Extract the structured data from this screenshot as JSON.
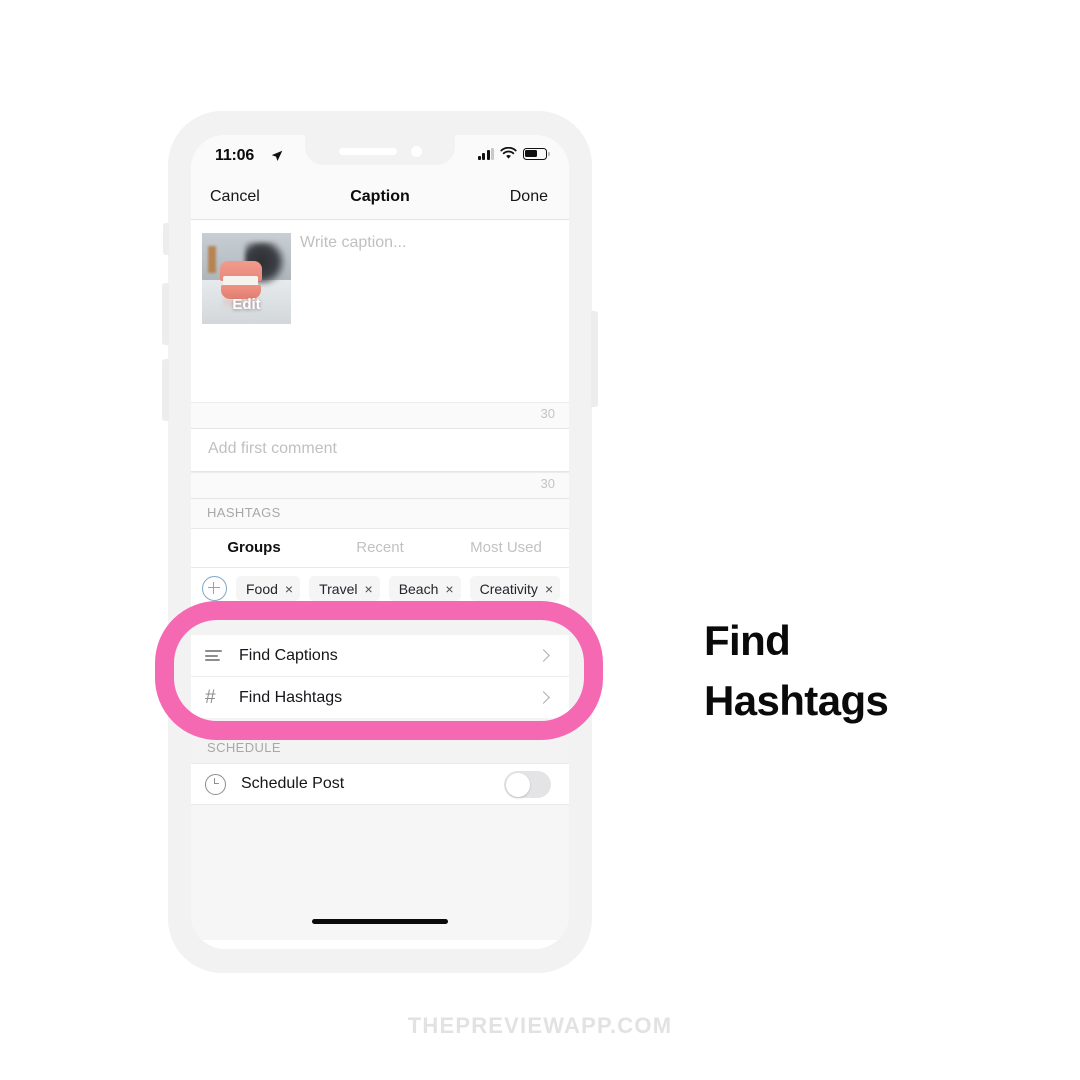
{
  "status_bar": {
    "time": "11:06",
    "location_icon": "location-arrow-icon",
    "signal_icon": "cellular-signal-icon",
    "wifi_icon": "wifi-icon",
    "battery_icon": "battery-icon"
  },
  "nav_bar": {
    "cancel_label": "Cancel",
    "title": "Caption",
    "done_label": "Done"
  },
  "caption": {
    "thumbnail_overlay_label": "Edit",
    "placeholder": "Write caption...",
    "counter": "30"
  },
  "first_comment": {
    "placeholder": "Add first comment",
    "counter": "30"
  },
  "hashtags": {
    "section_label": "HASHTAGS",
    "tabs": [
      {
        "label": "Groups",
        "active": true
      },
      {
        "label": "Recent",
        "active": false
      },
      {
        "label": "Most Used",
        "active": false
      }
    ],
    "add_icon": "plus-circle-icon",
    "add_icon_color": "#7fa8c9",
    "chips": [
      {
        "label": "Food",
        "remove": "×"
      },
      {
        "label": "Travel",
        "remove": "×"
      },
      {
        "label": "Beach",
        "remove": "×"
      },
      {
        "label": "Creativity",
        "remove": "×"
      }
    ]
  },
  "find_list": [
    {
      "icon": "text-lines-icon",
      "label": "Find Captions",
      "chevron": "chevron-right-icon"
    },
    {
      "icon": "hash-icon",
      "glyph": "#",
      "label": "Find Hashtags",
      "chevron": "chevron-right-icon"
    }
  ],
  "schedule": {
    "section_label": "SCHEDULE",
    "icon": "clock-icon",
    "label": "Schedule Post",
    "toggle_state": "off"
  },
  "annotation": {
    "line1": "Find",
    "line2": "Hashtags",
    "highlight_color": "#F569B2"
  },
  "watermark": {
    "text": "THEPREVIEWAPP.COM"
  }
}
